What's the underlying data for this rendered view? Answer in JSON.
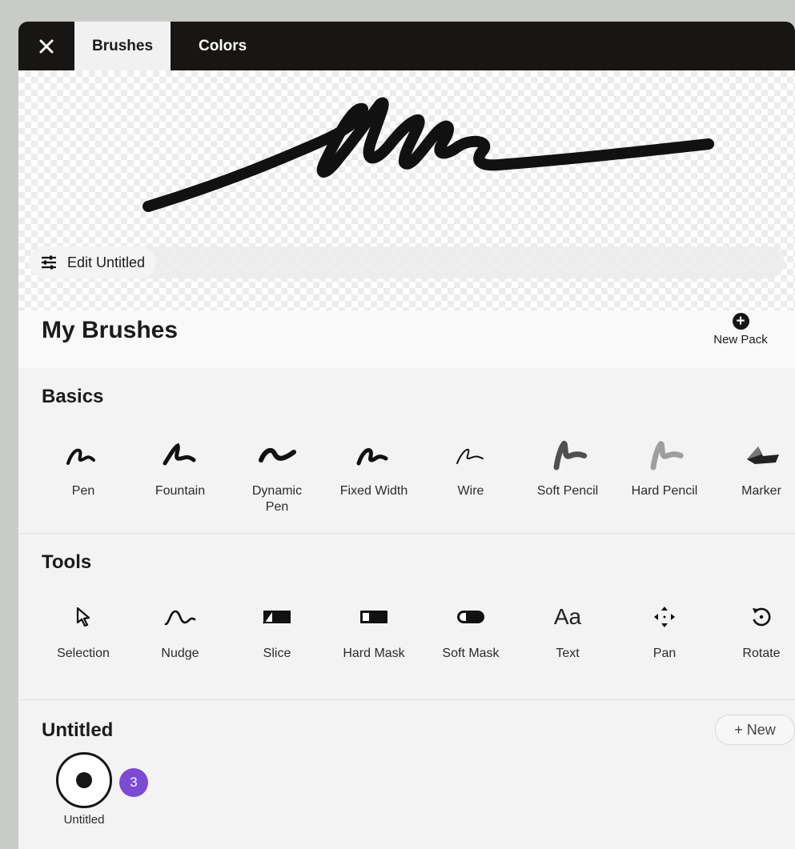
{
  "tabs": [
    {
      "label": "Brushes",
      "active": true
    },
    {
      "label": "Colors",
      "active": false
    }
  ],
  "edit": {
    "label": "Edit Untitled"
  },
  "header": {
    "title": "My Brushes",
    "new_pack_label": "New Pack"
  },
  "basics": {
    "title": "Basics",
    "items": [
      {
        "label": "Pen",
        "icon": "pen-stroke-icon"
      },
      {
        "label": "Fountain",
        "icon": "fountain-stroke-icon"
      },
      {
        "label": "Dynamic\nPen",
        "icon": "dynamic-pen-stroke-icon"
      },
      {
        "label": "Fixed Width",
        "icon": "fixed-width-stroke-icon"
      },
      {
        "label": "Wire",
        "icon": "wire-stroke-icon"
      },
      {
        "label": "Soft Pencil",
        "icon": "soft-pencil-stroke-icon"
      },
      {
        "label": "Hard Pencil",
        "icon": "hard-pencil-stroke-icon"
      },
      {
        "label": "Marker",
        "icon": "marker-stroke-icon"
      }
    ]
  },
  "tools": {
    "title": "Tools",
    "items": [
      {
        "label": "Selection",
        "icon": "selection-arrow-icon"
      },
      {
        "label": "Nudge",
        "icon": "nudge-curve-icon"
      },
      {
        "label": "Slice",
        "icon": "slice-icon"
      },
      {
        "label": "Hard Mask",
        "icon": "hard-mask-icon"
      },
      {
        "label": "Soft Mask",
        "icon": "soft-mask-icon"
      },
      {
        "label": "Text",
        "icon": "text-aa-icon",
        "glyph": "Aa"
      },
      {
        "label": "Pan",
        "icon": "pan-arrows-icon"
      },
      {
        "label": "Rotate",
        "icon": "rotate-icon"
      }
    ]
  },
  "untitled": {
    "title": "Untitled",
    "new_label": "+ New",
    "item_label": "Untitled",
    "badge_count": "3"
  },
  "colors": {
    "accent_badge": "#7b4ad6",
    "topbar": "#181614"
  }
}
